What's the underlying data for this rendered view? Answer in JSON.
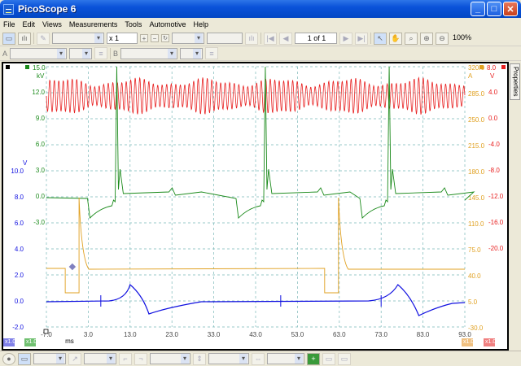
{
  "window": {
    "title": "PicoScope 6"
  },
  "menu": [
    "File",
    "Edit",
    "Views",
    "Measurements",
    "Tools",
    "Automotive",
    "Help"
  ],
  "toolbar": {
    "multiplier": "x 1",
    "page_indicator": "1 of 1",
    "zoom": "100%"
  },
  "trigger_bar": {
    "ch_a_label": "A",
    "ch_b_label": "B"
  },
  "properties_tab": "Properties",
  "axes": {
    "x_ticks": [
      "-7.0",
      "3.0",
      "13.0",
      "23.0",
      "33.0",
      "43.0",
      "53.0",
      "63.0",
      "73.0",
      "83.0",
      "93.0"
    ],
    "x_unit": "ms",
    "left_green": {
      "unit": "kV",
      "top": "15.0",
      "ticks": [
        "12.0",
        "9.0",
        "6.0",
        "3.0",
        "0.0",
        "-3.0"
      ]
    },
    "left_blue": {
      "unit": "V",
      "ticks": [
        "10.0",
        "8.0",
        "6.0",
        "4.0",
        "2.0",
        "0.0",
        "-2.0"
      ]
    },
    "right_orange": {
      "unit": "A",
      "ticks": [
        "320.0",
        "285.0",
        "250.0",
        "215.0",
        "180.0",
        "145.0",
        "110.0",
        "75.0",
        "40.0",
        "5.0",
        "-30.0"
      ]
    },
    "right_red": {
      "unit": "V",
      "top": "8.0",
      "ticks": [
        "4.0",
        "0.0",
        "-4.0",
        "-8.0",
        "-12.0",
        "-16.0",
        "-20.0"
      ]
    }
  },
  "colors": {
    "green": "#1a8a1a",
    "blue": "#1010e0",
    "orange": "#e0a020",
    "red": "#e82020",
    "grid": "#7ab8b8"
  },
  "channel_boxes": [
    {
      "name": "ch-blue-box",
      "label": "x1.0",
      "color": "#8080e8"
    },
    {
      "name": "ch-green-box",
      "label": "x1.0",
      "color": "#70c070"
    },
    {
      "name": "ch-orange-box",
      "label": "x1.0",
      "color": "#f0c080"
    },
    {
      "name": "ch-red-box",
      "label": "x1.0",
      "color": "#f08080"
    }
  ]
}
